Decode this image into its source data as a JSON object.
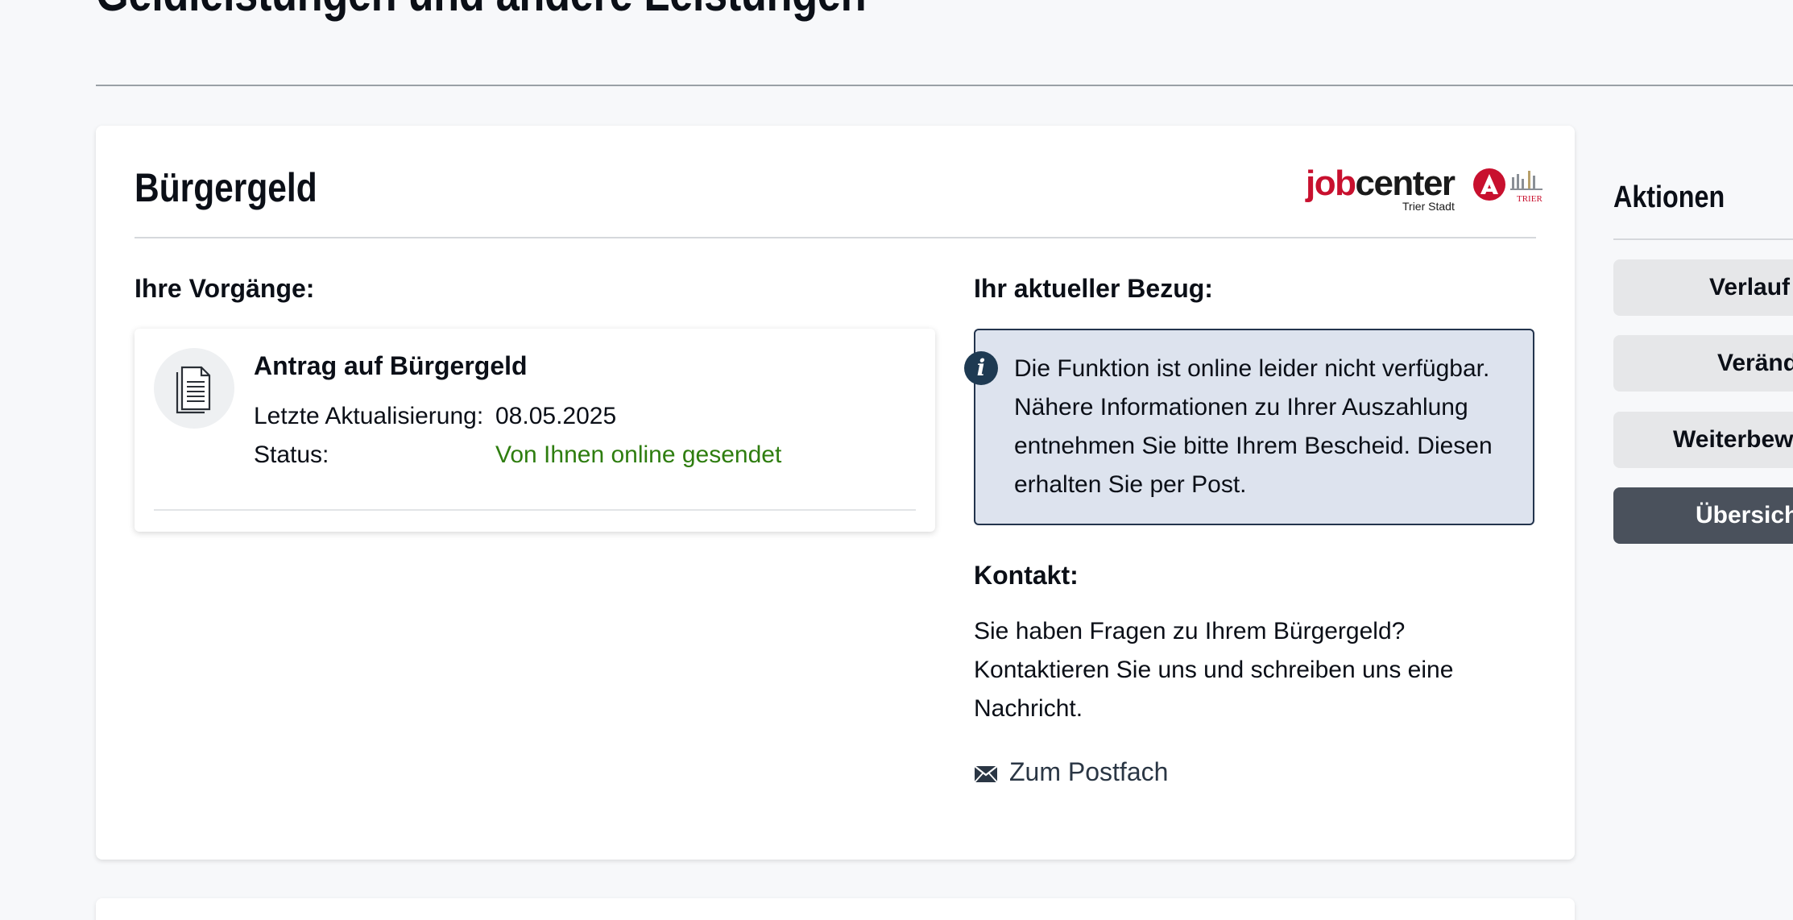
{
  "page": {
    "title": "Geldleistungen und andere Leistungen"
  },
  "card": {
    "title": "Bürgergeld",
    "logo": {
      "word_job": "job",
      "word_center": "center",
      "subtitle": "Trier Stadt",
      "city_label": "TRIER",
      "brand_color": "#c8102e"
    },
    "processes": {
      "label": "Ihre Vorgänge:",
      "items": [
        {
          "icon": "document-icon",
          "title": "Antrag auf Bürgergeld",
          "updated_label": "Letzte Aktualisierung:",
          "updated_value": "08.05.2025",
          "status_label": "Status:",
          "status_value": "Von Ihnen online gesendet",
          "status_color": "#2e7d0f"
        }
      ]
    },
    "current": {
      "label": "Ihr aktueller Bezug:",
      "info_icon": "info-icon",
      "info_text": "Die Funktion ist online leider nicht verfüg­bar. Nähere Informationen zu Ihrer Aus­zahlung entnehmen Sie bitte Ihrem Be­scheid. Diesen erhalten Sie per Post."
    },
    "contact": {
      "label": "Kontakt:",
      "text": "Sie haben Fragen zu Ihrem Bürgergeld? Kontaktieren Sie uns und schreiben uns eine Nachricht.",
      "link_icon": "envelope-icon",
      "link_label": "Zum Postfach"
    }
  },
  "actions": {
    "title": "Aktionen",
    "buttons": [
      {
        "label": "Verlauf"
      },
      {
        "label": "Veränd"
      },
      {
        "label": "Weiterbew"
      },
      {
        "label": "Übersich"
      }
    ]
  }
}
